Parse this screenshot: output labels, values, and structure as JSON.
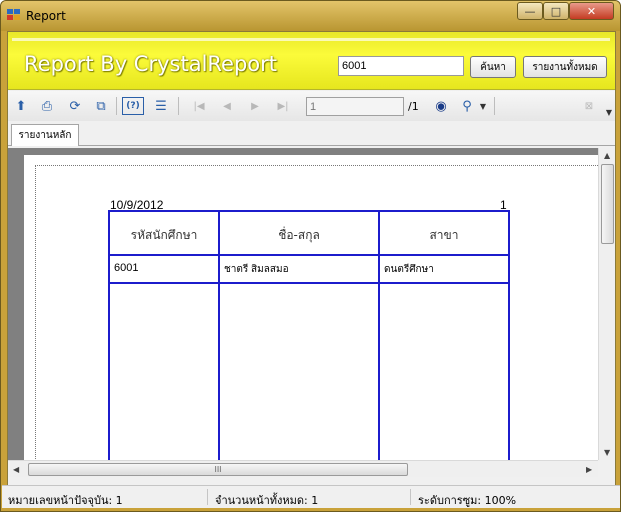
{
  "window": {
    "title": "Report"
  },
  "header": {
    "title": "Report By CrystalReport",
    "search_value": "6001",
    "search_button": "ค้นหา",
    "all_button": "รายงานทั้งหมด"
  },
  "toolbar": {
    "page_value": "1",
    "page_total": "/1"
  },
  "tabs": [
    {
      "label": "รายงานหลัก"
    }
  ],
  "report": {
    "date": "10/9/2012",
    "page_number": "1",
    "columns": [
      "รหัสนักศึกษา",
      "ชื่อ-สกุล",
      "สาขา"
    ],
    "rows": [
      [
        "6001",
        "ชาตรี สิมลสมอ",
        "ดนตรีศึกษา"
      ]
    ]
  },
  "scroll": {
    "hthumb_label": "III"
  },
  "status": {
    "current_page": "หมายเลขหน้าปัจจุบัน: 1",
    "total_pages": "จำนวนหน้าทั้งหมด: 1",
    "zoom": "ระดับการซูม: 100%"
  },
  "colors": {
    "header_yellow": "#f5f52a",
    "table_line": "#1c1ccc",
    "titlebar": "#d4b44e"
  }
}
